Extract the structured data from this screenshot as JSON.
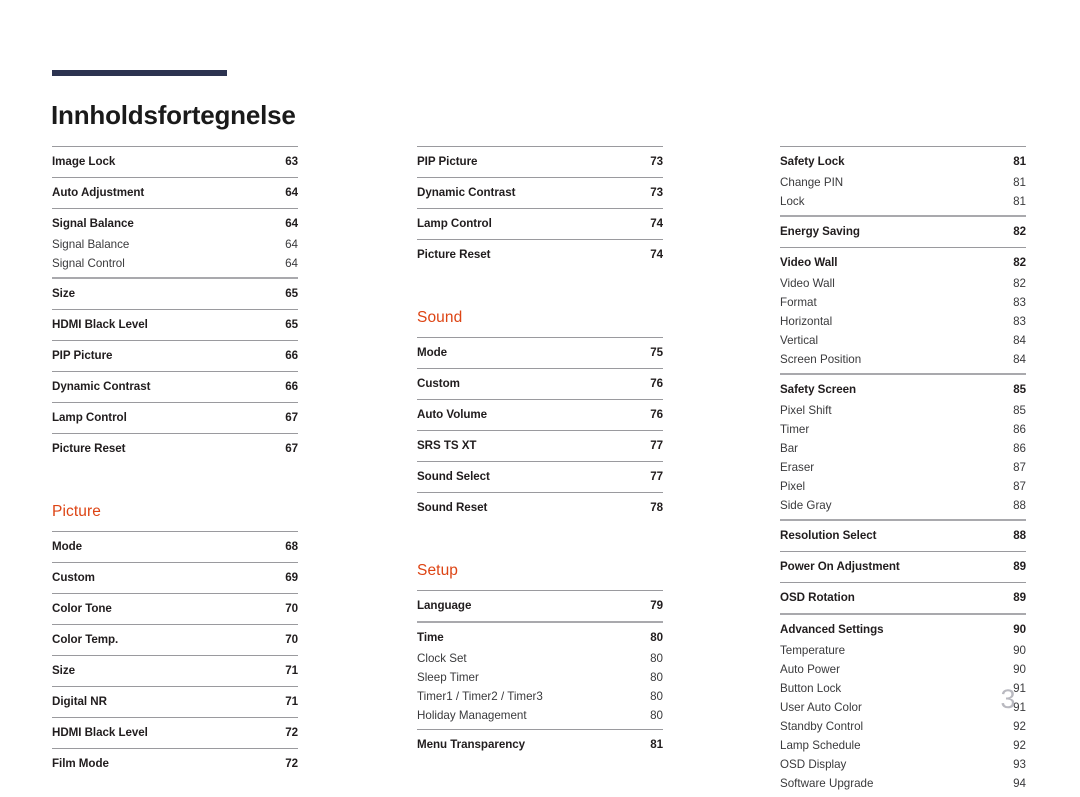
{
  "document": {
    "title": "Innholdsfortegnelse",
    "folio": "3",
    "accent_color": "#2c3350",
    "section_color": "#dd4414",
    "rule_color": "#9a9a9e"
  },
  "columns": [
    {
      "name": "column-1",
      "blocks": [
        {
          "type": "group",
          "rule": "thin",
          "entries": [
            {
              "label": "Image Lock",
              "page": "63",
              "level": "main"
            }
          ]
        },
        {
          "type": "group",
          "rule": "thin",
          "entries": [
            {
              "label": "Auto Adjustment",
              "page": "64",
              "level": "main"
            }
          ]
        },
        {
          "type": "group",
          "rule": "thin",
          "entries": [
            {
              "label": "Signal Balance",
              "page": "64",
              "level": "main"
            },
            {
              "label": "Signal Balance",
              "page": "64",
              "level": "sub"
            },
            {
              "label": "Signal Control",
              "page": "64",
              "level": "sub"
            }
          ]
        },
        {
          "type": "group",
          "rule": "thick",
          "entries": [
            {
              "label": "Size",
              "page": "65",
              "level": "main"
            }
          ]
        },
        {
          "type": "group",
          "rule": "thin",
          "entries": [
            {
              "label": "HDMI Black Level",
              "page": "65",
              "level": "main"
            }
          ]
        },
        {
          "type": "group",
          "rule": "thin",
          "entries": [
            {
              "label": "PIP Picture",
              "page": "66",
              "level": "main"
            }
          ]
        },
        {
          "type": "group",
          "rule": "thin",
          "entries": [
            {
              "label": "Dynamic Contrast",
              "page": "66",
              "level": "main"
            }
          ]
        },
        {
          "type": "group",
          "rule": "thin",
          "entries": [
            {
              "label": "Lamp Control",
              "page": "67",
              "level": "main"
            }
          ]
        },
        {
          "type": "group",
          "rule": "thin",
          "entries": [
            {
              "label": "Picture Reset",
              "page": "67",
              "level": "main"
            }
          ]
        },
        {
          "type": "heading",
          "label": "Picture"
        },
        {
          "type": "group",
          "rule": "thin",
          "entries": [
            {
              "label": "Mode",
              "page": "68",
              "level": "main"
            }
          ]
        },
        {
          "type": "group",
          "rule": "thin",
          "entries": [
            {
              "label": "Custom",
              "page": "69",
              "level": "main"
            }
          ]
        },
        {
          "type": "group",
          "rule": "thin",
          "entries": [
            {
              "label": "Color Tone",
              "page": "70",
              "level": "main"
            }
          ]
        },
        {
          "type": "group",
          "rule": "thin",
          "entries": [
            {
              "label": "Color Temp.",
              "page": "70",
              "level": "main"
            }
          ]
        },
        {
          "type": "group",
          "rule": "thin",
          "entries": [
            {
              "label": "Size",
              "page": "71",
              "level": "main"
            }
          ]
        },
        {
          "type": "group",
          "rule": "thin",
          "entries": [
            {
              "label": "Digital NR",
              "page": "71",
              "level": "main"
            }
          ]
        },
        {
          "type": "group",
          "rule": "thin",
          "entries": [
            {
              "label": "HDMI Black Level",
              "page": "72",
              "level": "main"
            }
          ]
        },
        {
          "type": "group",
          "rule": "thin",
          "entries": [
            {
              "label": "Film Mode",
              "page": "72",
              "level": "main"
            }
          ]
        }
      ]
    },
    {
      "name": "column-2",
      "blocks": [
        {
          "type": "group",
          "rule": "thin",
          "entries": [
            {
              "label": "PIP Picture",
              "page": "73",
              "level": "main"
            }
          ]
        },
        {
          "type": "group",
          "rule": "thin",
          "entries": [
            {
              "label": "Dynamic Contrast",
              "page": "73",
              "level": "main"
            }
          ]
        },
        {
          "type": "group",
          "rule": "thin",
          "entries": [
            {
              "label": "Lamp Control",
              "page": "74",
              "level": "main"
            }
          ]
        },
        {
          "type": "group",
          "rule": "thin",
          "entries": [
            {
              "label": "Picture Reset",
              "page": "74",
              "level": "main"
            }
          ]
        },
        {
          "type": "heading",
          "label": "Sound"
        },
        {
          "type": "group",
          "rule": "thin",
          "entries": [
            {
              "label": "Mode",
              "page": "75",
              "level": "main"
            }
          ]
        },
        {
          "type": "group",
          "rule": "thin",
          "entries": [
            {
              "label": "Custom",
              "page": "76",
              "level": "main"
            }
          ]
        },
        {
          "type": "group",
          "rule": "thin",
          "entries": [
            {
              "label": "Auto Volume",
              "page": "76",
              "level": "main"
            }
          ]
        },
        {
          "type": "group",
          "rule": "thin",
          "entries": [
            {
              "label": "SRS TS XT",
              "page": "77",
              "level": "main"
            }
          ]
        },
        {
          "type": "group",
          "rule": "thin",
          "entries": [
            {
              "label": "Sound Select",
              "page": "77",
              "level": "main"
            }
          ]
        },
        {
          "type": "group",
          "rule": "thin",
          "entries": [
            {
              "label": "Sound Reset",
              "page": "78",
              "level": "main"
            }
          ]
        },
        {
          "type": "heading",
          "label": "Setup"
        },
        {
          "type": "group",
          "rule": "thin",
          "entries": [
            {
              "label": "Language",
              "page": "79",
              "level": "main"
            }
          ]
        },
        {
          "type": "group",
          "rule": "thick",
          "entries": [
            {
              "label": "Time",
              "page": "80",
              "level": "main"
            },
            {
              "label": "Clock Set",
              "page": "80",
              "level": "sub"
            },
            {
              "label": "Sleep Timer",
              "page": "80",
              "level": "sub"
            },
            {
              "label": "Timer1 / Timer2 / Timer3",
              "page": "80",
              "level": "sub"
            },
            {
              "label": "Holiday Management",
              "page": "80",
              "level": "sub"
            }
          ]
        },
        {
          "type": "group",
          "rule": "thin",
          "entries": [
            {
              "label": "Menu Transparency",
              "page": "81",
              "level": "main"
            }
          ]
        }
      ]
    },
    {
      "name": "column-3",
      "blocks": [
        {
          "type": "group",
          "rule": "thin",
          "entries": [
            {
              "label": "Safety Lock",
              "page": "81",
              "level": "main"
            },
            {
              "label": "Change PIN",
              "page": "81",
              "level": "sub"
            },
            {
              "label": "Lock",
              "page": "81",
              "level": "sub"
            }
          ]
        },
        {
          "type": "group",
          "rule": "thick",
          "entries": [
            {
              "label": "Energy Saving",
              "page": "82",
              "level": "main"
            }
          ]
        },
        {
          "type": "group",
          "rule": "thin",
          "entries": [
            {
              "label": "Video Wall",
              "page": "82",
              "level": "main"
            },
            {
              "label": "Video Wall",
              "page": "82",
              "level": "sub"
            },
            {
              "label": "Format",
              "page": "83",
              "level": "sub"
            },
            {
              "label": "Horizontal",
              "page": "83",
              "level": "sub"
            },
            {
              "label": "Vertical",
              "page": "84",
              "level": "sub"
            },
            {
              "label": "Screen Position",
              "page": "84",
              "level": "sub"
            }
          ]
        },
        {
          "type": "group",
          "rule": "thick",
          "entries": [
            {
              "label": "Safety Screen",
              "page": "85",
              "level": "main"
            },
            {
              "label": "Pixel Shift",
              "page": "85",
              "level": "sub"
            },
            {
              "label": "Timer",
              "page": "86",
              "level": "sub"
            },
            {
              "label": "Bar",
              "page": "86",
              "level": "sub"
            },
            {
              "label": "Eraser",
              "page": "87",
              "level": "sub"
            },
            {
              "label": "Pixel",
              "page": "87",
              "level": "sub"
            },
            {
              "label": "Side Gray",
              "page": "88",
              "level": "sub"
            }
          ]
        },
        {
          "type": "group",
          "rule": "thick",
          "entries": [
            {
              "label": "Resolution Select",
              "page": "88",
              "level": "main"
            }
          ]
        },
        {
          "type": "group",
          "rule": "thin",
          "entries": [
            {
              "label": "Power On Adjustment",
              "page": "89",
              "level": "main"
            }
          ]
        },
        {
          "type": "group",
          "rule": "thin",
          "entries": [
            {
              "label": "OSD Rotation",
              "page": "89",
              "level": "main"
            }
          ]
        },
        {
          "type": "group",
          "rule": "thick",
          "entries": [
            {
              "label": "Advanced Settings",
              "page": "90",
              "level": "main"
            },
            {
              "label": "Temperature",
              "page": "90",
              "level": "sub"
            },
            {
              "label": "Auto Power",
              "page": "90",
              "level": "sub"
            },
            {
              "label": "Button Lock",
              "page": "91",
              "level": "sub"
            },
            {
              "label": "User Auto Color",
              "page": "91",
              "level": "sub"
            },
            {
              "label": "Standby Control",
              "page": "92",
              "level": "sub"
            },
            {
              "label": "Lamp Schedule",
              "page": "92",
              "level": "sub"
            },
            {
              "label": "OSD Display",
              "page": "93",
              "level": "sub"
            },
            {
              "label": "Software Upgrade",
              "page": "94",
              "level": "sub"
            }
          ]
        }
      ]
    }
  ]
}
